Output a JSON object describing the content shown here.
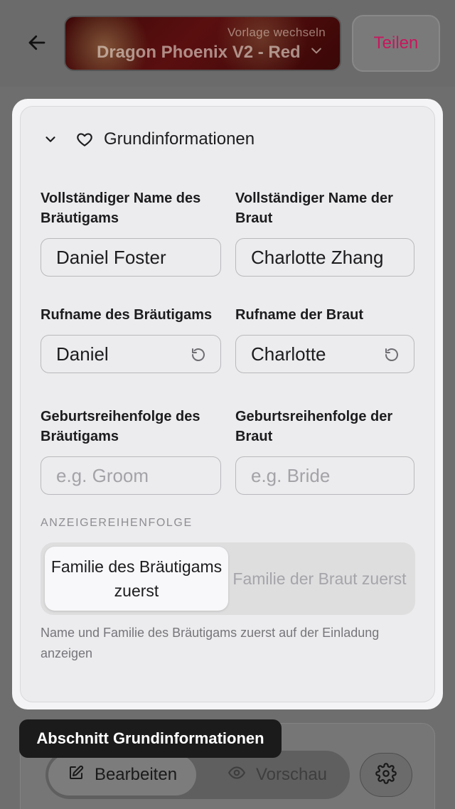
{
  "header": {
    "template_hint": "Vorlage wechseln",
    "template_name": "Dragon Phoenix V2 - Red",
    "share_label": "Teilen"
  },
  "section": {
    "title": "Grundinformationen"
  },
  "fields": {
    "groom_full_name_label": "Vollständiger Name des Bräutigams",
    "groom_full_name_value": "Daniel Foster",
    "bride_full_name_label": "Vollständiger Name der Braut",
    "bride_full_name_value": "Charlotte Zhang",
    "groom_nickname_label": "Rufname des Bräutigams",
    "groom_nickname_value": "Daniel",
    "bride_nickname_label": "Rufname der Braut",
    "bride_nickname_value": "Charlotte",
    "groom_birth_order_label": "Geburtsreihenfolge des Bräutigams",
    "groom_birth_order_placeholder": "e.g. Groom",
    "bride_birth_order_label": "Geburtsreihenfolge der Braut",
    "bride_birth_order_placeholder": "e.g. Bride"
  },
  "display_order": {
    "label": "ANZEIGEREIHENFOLGE",
    "option_groom_first": "Familie des Bräutigams zuerst",
    "option_bride_first": "Familie der Braut zuerst",
    "selected": "option_groom_first",
    "hint": "Name und Familie des Bräutigams zuerst auf der Einladung anzeigen"
  },
  "tooltip": {
    "text": "Abschnitt Grundinformationen"
  },
  "bottom_bar": {
    "edit_label": "Bearbeiten",
    "preview_label": "Vorschau"
  },
  "colors": {
    "accent": "#c8175d",
    "template_bg": "#4a0b0b"
  }
}
